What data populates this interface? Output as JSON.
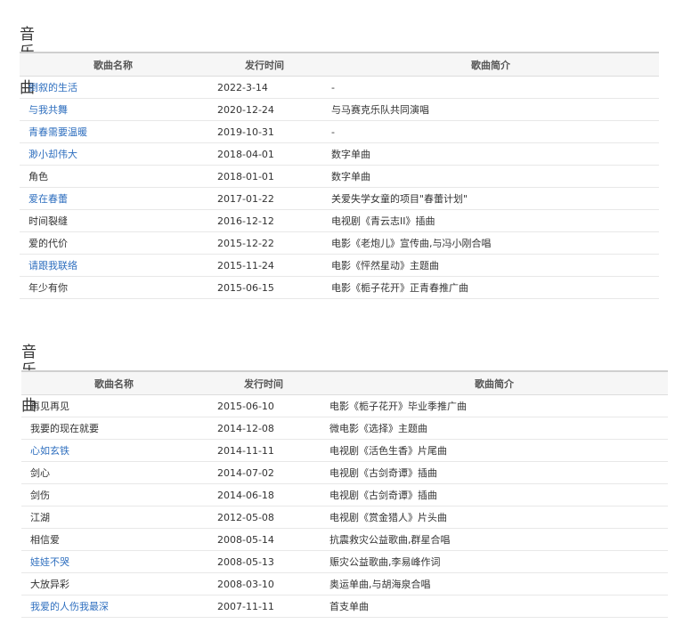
{
  "sections": [
    {
      "title": "音乐单曲",
      "headers": [
        "歌曲名称",
        "发行时间",
        "歌曲简介"
      ],
      "rows": [
        {
          "name": "倒叙的生活",
          "date": "2022-3-14",
          "desc": "-",
          "linked": true
        },
        {
          "name": "与我共舞",
          "date": "2020-12-24",
          "desc": "与马赛克乐队共同演唱",
          "linked": true
        },
        {
          "name": "青春需要温暖",
          "date": "2019-10-31",
          "desc": "-",
          "linked": true
        },
        {
          "name": "渺小却伟大",
          "date": "2018-04-01",
          "desc": "数字单曲",
          "linked": true
        },
        {
          "name": "角色",
          "date": "2018-01-01",
          "desc": "数字单曲",
          "linked": false
        },
        {
          "name": "爱在春蕾",
          "date": "2017-01-22",
          "desc": "关爱失学女童的项目\"春蕾计划\"",
          "linked": true
        },
        {
          "name": "时间裂缝",
          "date": "2016-12-12",
          "desc": "电视剧《青云志II》插曲",
          "linked": false
        },
        {
          "name": "爱的代价",
          "date": "2015-12-22",
          "desc": "电影《老炮儿》宣传曲,与冯小刚合唱",
          "linked": false
        },
        {
          "name": "请跟我联络",
          "date": "2015-11-24",
          "desc": "电影《怦然星动》主题曲",
          "linked": true
        },
        {
          "name": "年少有你",
          "date": "2015-06-15",
          "desc": "电影《栀子花开》正青春推广曲",
          "linked": false
        }
      ]
    },
    {
      "title": "音乐单曲",
      "headers": [
        "歌曲名称",
        "发行时间",
        "歌曲简介"
      ],
      "rows": [
        {
          "name": "再见再见",
          "date": "2015-06-10",
          "desc": "电影《栀子花开》毕业季推广曲",
          "linked": false
        },
        {
          "name": "我要的现在就要",
          "date": "2014-12-08",
          "desc": "微电影《选择》主题曲",
          "linked": false
        },
        {
          "name": "心如玄铁",
          "date": "2014-11-11",
          "desc": "电视剧《活色生香》片尾曲",
          "linked": true
        },
        {
          "name": "剑心",
          "date": "2014-07-02",
          "desc": "电视剧《古剑奇谭》插曲",
          "linked": false
        },
        {
          "name": "剑伤",
          "date": "2014-06-18",
          "desc": "电视剧《古剑奇谭》插曲",
          "linked": false
        },
        {
          "name": "江湖",
          "date": "2012-05-08",
          "desc": "电视剧《赏金猎人》片头曲",
          "linked": false
        },
        {
          "name": "相信爱",
          "date": "2008-05-14",
          "desc": "抗震救灾公益歌曲,群星合唱",
          "linked": false
        },
        {
          "name": "娃娃不哭",
          "date": "2008-05-13",
          "desc": "赈灾公益歌曲,李易峰作词",
          "linked": true
        },
        {
          "name": "大放异彩",
          "date": "2008-03-10",
          "desc": "奥运单曲,与胡海泉合唱",
          "linked": false
        },
        {
          "name": "我爱的人伤我最深",
          "date": "2007-11-11",
          "desc": "首支单曲",
          "linked": true
        }
      ]
    }
  ]
}
